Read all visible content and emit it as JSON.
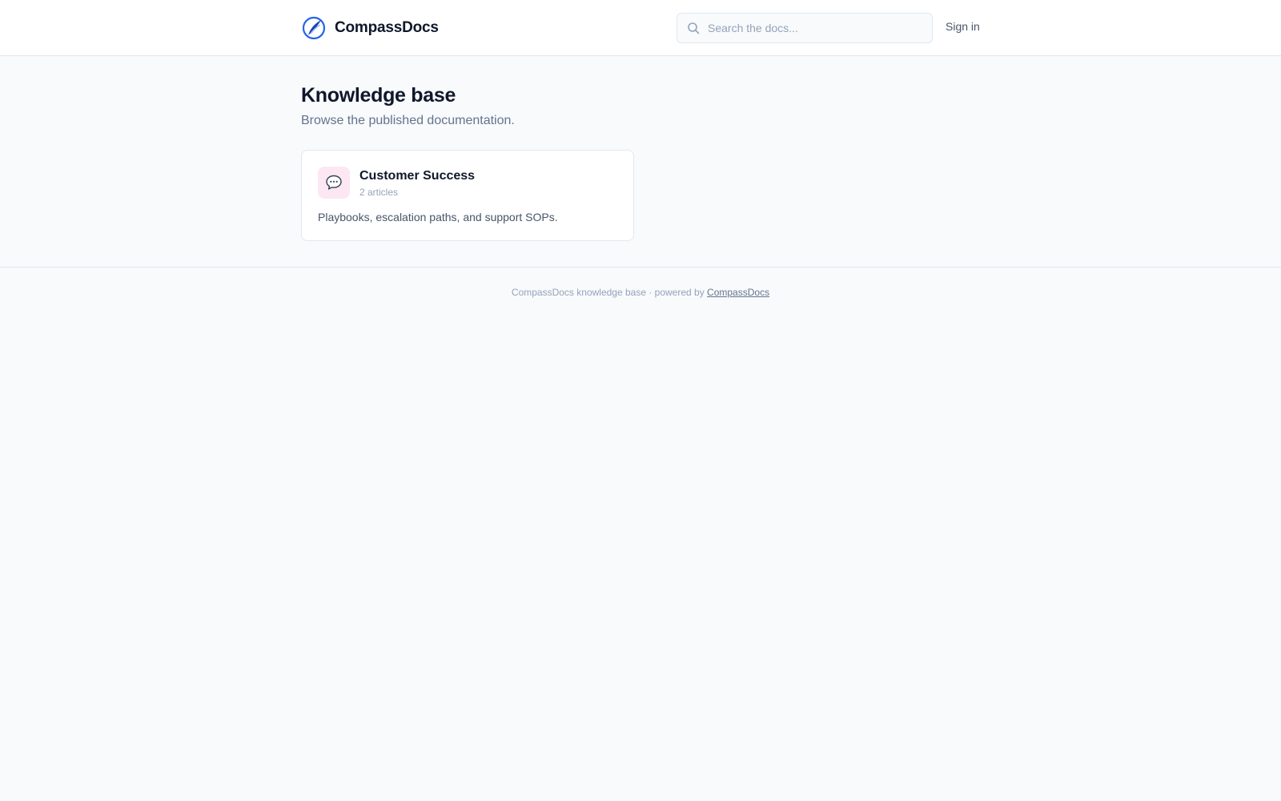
{
  "header": {
    "brand_name": "CompassDocs",
    "search_placeholder": "Search the docs...",
    "sign_in_label": "Sign in"
  },
  "main": {
    "title": "Knowledge base",
    "subtitle": "Browse the published documentation.",
    "collections": [
      {
        "title": "Customer Success",
        "count": "2 articles",
        "description": "Playbooks, escalation paths, and support SOPs.",
        "icon": "speech-bubble-icon",
        "icon_bg": "#fce7f3"
      }
    ]
  },
  "footer": {
    "text": "CompassDocs knowledge base · powered by",
    "link_label": "CompassDocs"
  },
  "colors": {
    "page_bg": "#f8fafc",
    "brand_blue": "#2563eb",
    "text_dark": "#0f172a",
    "text_muted": "#64748b"
  }
}
